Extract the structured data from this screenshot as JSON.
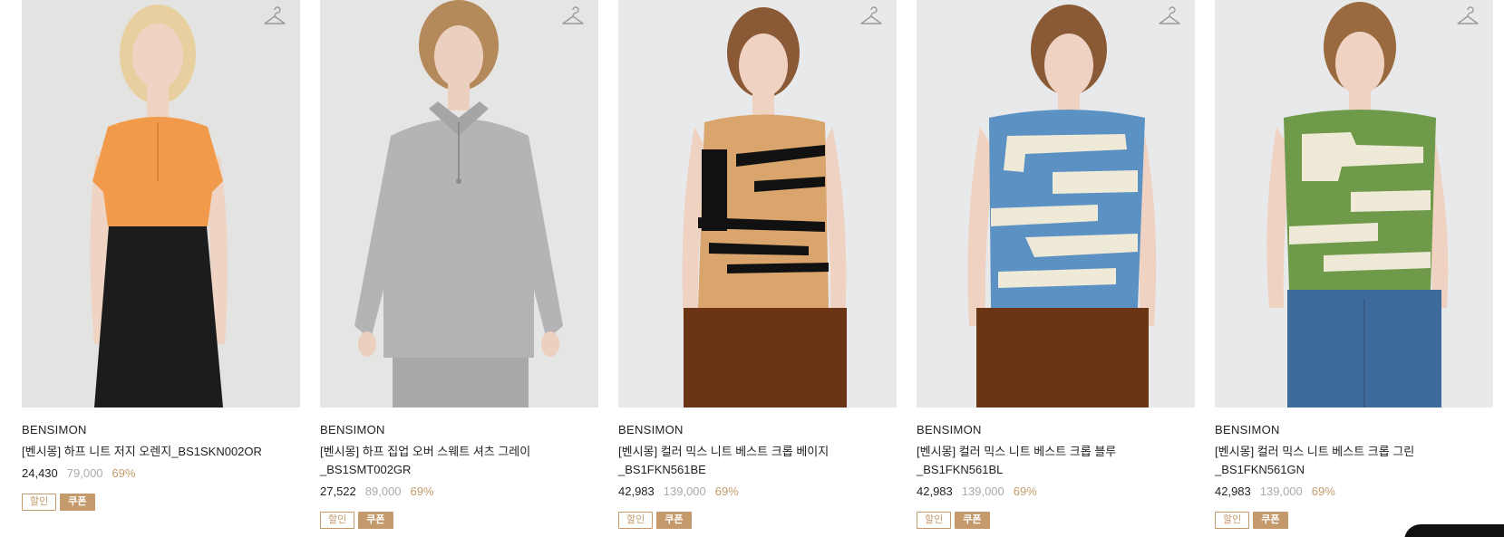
{
  "products": [
    {
      "brand": "BENSIMON",
      "name": "[벤시몽] 하프 니트 저지 오렌지_BS1SKN002OR",
      "sale_price": "24,430",
      "original_price": "79,000",
      "discount": "69%",
      "badges": [
        "할인",
        "쿠폰"
      ],
      "image": {
        "bg": "#e3e3e1",
        "top": "#f19a4c",
        "bottom": "#1c1c1c",
        "skin": "#efd4c4",
        "hair": "#e8cfa0"
      }
    },
    {
      "brand": "BENSIMON",
      "name": "[벤시몽] 하프 집업 오버 스웨트 셔츠 그레이_BS1SMT002GR",
      "sale_price": "27,522",
      "original_price": "89,000",
      "discount": "69%",
      "badges": [
        "할인",
        "쿠폰"
      ],
      "image": {
        "bg": "#e5e5e4",
        "top": "#b4b4b6",
        "bottom": "#a9a9ab",
        "skin": "#ecd0bf",
        "hair": "#b48a5a"
      }
    },
    {
      "brand": "BENSIMON",
      "name": "[벤시몽] 컬러 믹스 니트 베스트 크롭 베이지_BS1FKN561BE",
      "sale_price": "42,983",
      "original_price": "139,000",
      "discount": "69%",
      "badges": [
        "할인",
        "쿠폰"
      ],
      "image": {
        "bg": "#e8e9eb",
        "top": "#d9a56c",
        "bottom": "#6a3415",
        "skin": "#efd2c2",
        "hair": "#8a5a36",
        "stripe": "#111111"
      }
    },
    {
      "brand": "BENSIMON",
      "name": "[벤시몽] 컬러 믹스 니트 베스트 크롭 블루_BS1FKN561BL",
      "sale_price": "42,983",
      "original_price": "139,000",
      "discount": "69%",
      "badges": [
        "할인",
        "쿠폰"
      ],
      "image": {
        "bg": "#e8e9eb",
        "top": "#5b92c3",
        "bottom": "#6a3415",
        "skin": "#efd2c2",
        "hair": "#8a5a36",
        "stripe": "#efe9d8"
      }
    },
    {
      "brand": "BENSIMON",
      "name": "[벤시몽] 컬러 믹스 니트 베스트 크롭 그린_BS1FKN561GN",
      "sale_price": "42,983",
      "original_price": "139,000",
      "discount": "69%",
      "badges": [
        "할인",
        "쿠폰"
      ],
      "image": {
        "bg": "#e8e9eb",
        "top": "#6e9a4a",
        "bottom": "#3f6b9c",
        "skin": "#efd2c2",
        "hair": "#9a6a3e",
        "stripe": "#efe9d8"
      }
    }
  ],
  "icons": {
    "wish": "hanger-icon"
  },
  "colors": {
    "accent": "#c49a6c",
    "sale_text": "#222222",
    "original_text": "#aaaaaa"
  }
}
